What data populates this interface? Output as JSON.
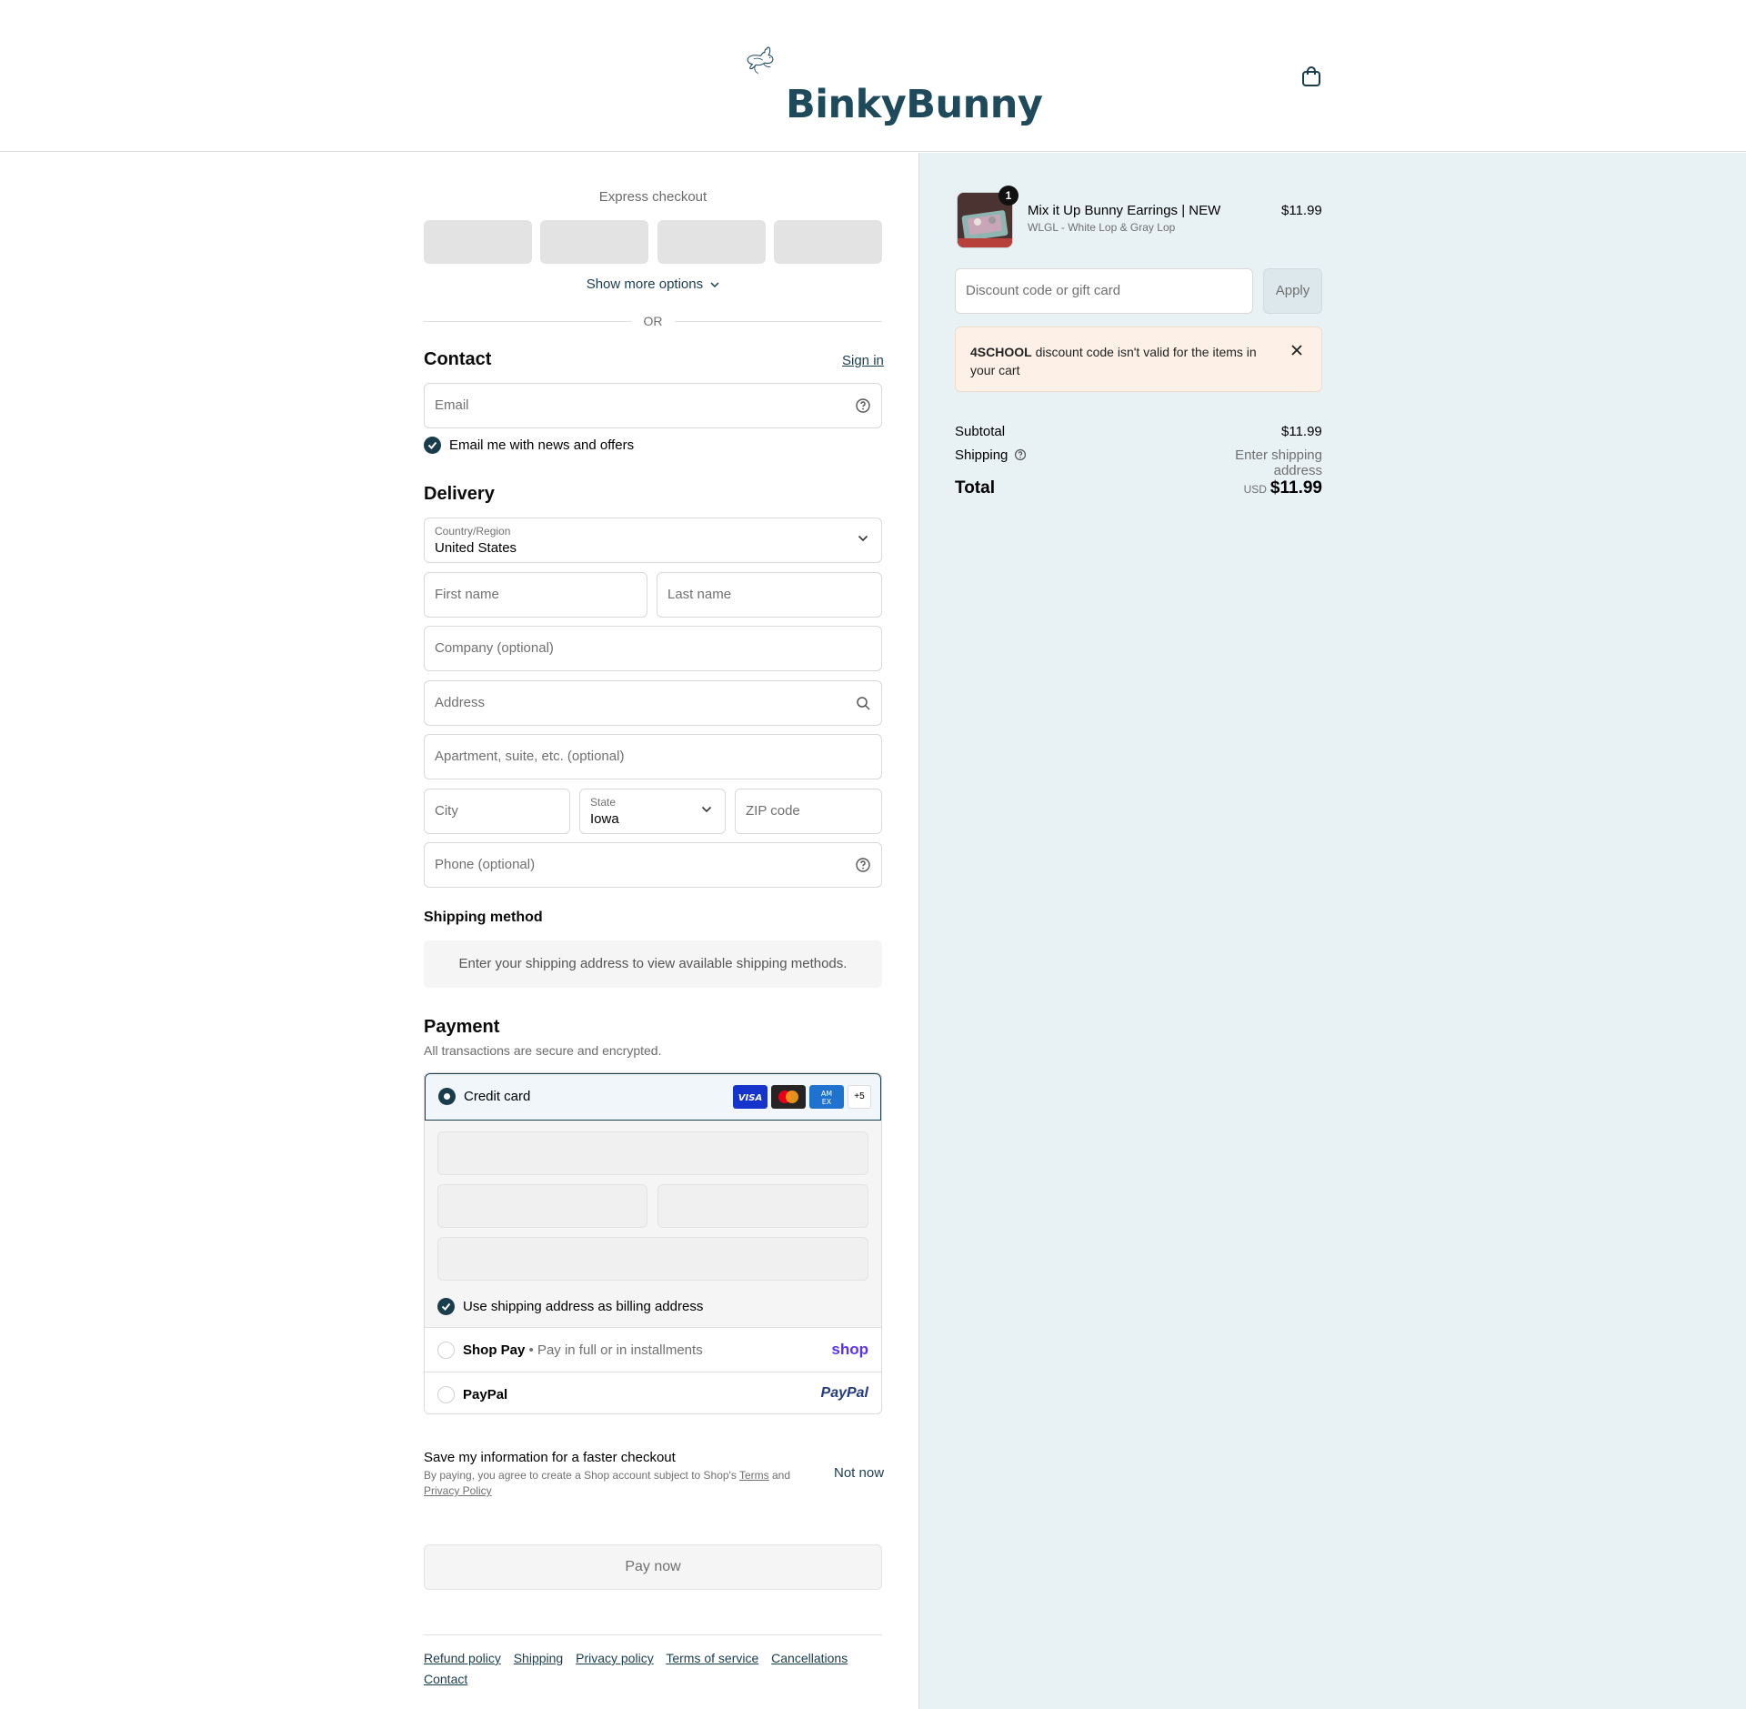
{
  "header": {
    "logo_text": "BinkyBunny"
  },
  "express": {
    "title": "Express checkout",
    "show_more": "Show more options",
    "or": "OR"
  },
  "contact": {
    "title": "Contact",
    "sign_in": "Sign in",
    "email_placeholder": "Email",
    "newsletter_label": "Email me with news and offers"
  },
  "delivery": {
    "title": "Delivery",
    "country_label": "Country/Region",
    "country_value": "United States",
    "first_name": "First name",
    "last_name": "Last name",
    "company": "Company (optional)",
    "address": "Address",
    "apartment": "Apartment, suite, etc. (optional)",
    "city": "City",
    "state_label": "State",
    "state_value": "Iowa",
    "zip": "ZIP code",
    "phone": "Phone (optional)"
  },
  "shipping_method": {
    "title": "Shipping method",
    "info": "Enter your shipping address to view available shipping methods."
  },
  "payment": {
    "title": "Payment",
    "subtitle": "All transactions are secure and encrypted.",
    "credit_card": "Credit card",
    "more_cards": "+5",
    "billing_label": "Use shipping address as billing address",
    "shop_pay": "Shop Pay",
    "shop_pay_desc": "• Pay in full or in installments",
    "shop_logo": "shop",
    "paypal": "PayPal",
    "paypal_logo": "PayPal"
  },
  "save_info": {
    "title": "Save my information for a faster checkout",
    "desc_prefix": "By paying, you agree to create a Shop account subject to Shop's",
    "terms": "Terms",
    "and": "and",
    "privacy": "Privacy Policy",
    "not_now": "Not now"
  },
  "pay_now": "Pay now",
  "footer": {
    "links": [
      "Refund policy",
      "Shipping",
      "Privacy policy",
      "Terms of service",
      "Cancellations",
      "Contact"
    ]
  },
  "summary": {
    "item_name": "Mix it Up Bunny Earrings | NEW",
    "item_variant": "WLGL - White Lop & Gray Lop",
    "item_price": "$11.99",
    "item_qty": "1",
    "discount_placeholder": "Discount code or gift card",
    "apply": "Apply",
    "alert_code": "4SCHOOL",
    "alert_text": " discount code isn't valid for the items in your cart",
    "subtotal_label": "Subtotal",
    "subtotal_value": "$11.99",
    "shipping_label": "Shipping",
    "shipping_value": "Enter shipping address",
    "total_label": "Total",
    "currency": "USD",
    "total_value": "$11.99"
  },
  "colors": {
    "brand": "#1a3d4d",
    "summary_bg": "#e8f2f4",
    "alert_bg": "#fdf1e7"
  }
}
